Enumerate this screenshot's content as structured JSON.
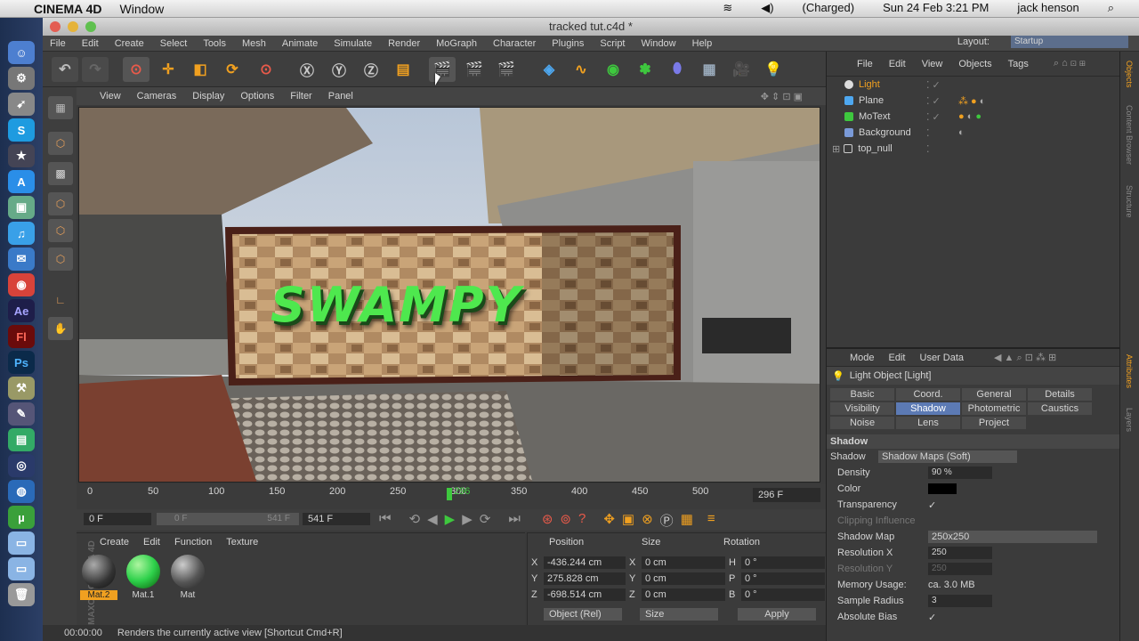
{
  "mac_menubar": {
    "app": "CINEMA 4D",
    "menu": "Window",
    "battery": "(Charged)",
    "clock": "Sun 24 Feb  3:21 PM",
    "user": "jack henson"
  },
  "window": {
    "title": "tracked tut.c4d *"
  },
  "app_menu": [
    "File",
    "Edit",
    "Create",
    "Select",
    "Tools",
    "Mesh",
    "Animate",
    "Simulate",
    "Render",
    "MoGraph",
    "Character",
    "Plugins",
    "Script",
    "Window",
    "Help"
  ],
  "layout": {
    "label": "Layout:",
    "value": "Startup"
  },
  "viewport_menu": [
    "View",
    "Cameras",
    "Display",
    "Options",
    "Filter",
    "Panel"
  ],
  "viewport_text": "SWAMPY",
  "timeline": {
    "ticks": [
      "0",
      "50",
      "100",
      "150",
      "200",
      "250",
      "300",
      "350",
      "400",
      "450",
      "500"
    ],
    "current": "296",
    "end_field": "296 F"
  },
  "transport": {
    "start": "0 F",
    "range_start": "0 F",
    "range_end": "541 F",
    "end": "541 F"
  },
  "material_menu": [
    "Create",
    "Edit",
    "Function",
    "Texture"
  ],
  "materials": [
    {
      "name": "Mat.2",
      "color": "#4a4a4a"
    },
    {
      "name": "Mat.1",
      "color": "#2ed14b"
    },
    {
      "name": "Mat",
      "color": "#555"
    }
  ],
  "coords": {
    "headers": [
      "Position",
      "Size",
      "Rotation"
    ],
    "rows": [
      {
        "a": "X",
        "pos": "-436.244 cm",
        "b": "X",
        "size": "0 cm",
        "c": "H",
        "rot": "0 °"
      },
      {
        "a": "Y",
        "pos": "275.828 cm",
        "b": "Y",
        "size": "0 cm",
        "c": "P",
        "rot": "0 °"
      },
      {
        "a": "Z",
        "pos": "-698.514 cm",
        "b": "Z",
        "size": "0 cm",
        "c": "B",
        "rot": "0 °"
      }
    ],
    "mode": "Object (Rel)",
    "size_mode": "Size",
    "apply": "Apply"
  },
  "status": {
    "time": "00:00:00",
    "text": "Renders the currently active view [Shortcut Cmd+R]"
  },
  "object_menu": [
    "File",
    "Edit",
    "View",
    "Objects",
    "Tags"
  ],
  "objects": [
    {
      "name": "Light",
      "active": true
    },
    {
      "name": "Plane",
      "active": false
    },
    {
      "name": "MoText",
      "active": false
    },
    {
      "name": "Background",
      "active": false
    },
    {
      "name": "top_null",
      "active": false
    }
  ],
  "attr_menu": [
    "Mode",
    "Edit",
    "User Data"
  ],
  "attr_title": "Light Object [Light]",
  "attr_tabs": [
    "Basic",
    "Coord.",
    "General",
    "Details",
    "Visibility",
    "Shadow",
    "Photometric",
    "Caustics",
    "Noise",
    "Lens",
    "Project"
  ],
  "attr_active_tab": "Shadow",
  "attr_section": "Shadow",
  "attrs": {
    "shadow_label": "Shadow",
    "shadow_value": "Shadow Maps (Soft)",
    "density_label": "Density",
    "density_value": "90 %",
    "color_label": "Color",
    "transparency_label": "Transparency",
    "clipping_label": "Clipping Influence",
    "shadowmap_label": "Shadow Map",
    "shadowmap_value": "250x250",
    "resx_label": "Resolution X",
    "resx_value": "250",
    "resy_label": "Resolution Y",
    "resy_value": "250",
    "mem_label": "Memory Usage:",
    "mem_value": "ca. 3.0 MB",
    "radius_label": "Sample Radius",
    "radius_value": "3",
    "bias_label": "Absolute Bias"
  },
  "side_tabs": [
    "Objects",
    "Content Browser",
    "Structure",
    "Attributes",
    "Layers"
  ]
}
